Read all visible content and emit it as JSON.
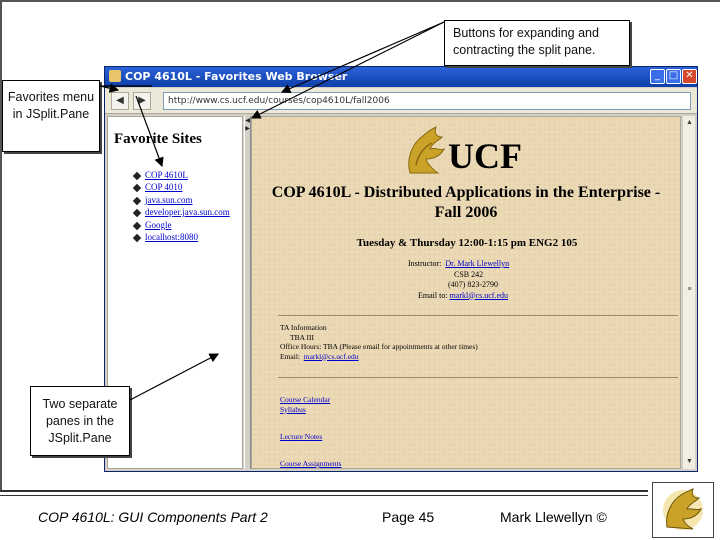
{
  "window": {
    "title": "COP 4610L - Favorites Web Browser",
    "min_glyph": "_",
    "max_glyph": "□",
    "close_glyph": "✕",
    "back_glyph": "◀",
    "forward_glyph": "▶",
    "address": "http://www.cs.ucf.edu/courses/cop4610L/fall2006"
  },
  "favorites": {
    "heading": "Favorite Sites",
    "items": [
      "COP 4610L",
      "COP 4010",
      "java.sun.com",
      "developer.java.sun.com",
      "Google",
      "localhost:8080"
    ]
  },
  "page": {
    "logo_text": "UCF",
    "course_title": "COP 4610L - Distributed Applications in the Enterprise - Fall 2006",
    "schedule": "Tuesday & Thursday 12:00-1:15 pm ENG2 105",
    "instructor_label": "Instructor:",
    "instructor_name": "Dr. Mark Llewellyn",
    "office": "CSB 242",
    "phone": "(407) 823-2790",
    "email_label": "Email to:",
    "email": "markl@cs.ucf.edu",
    "ta_heading": "TA Information",
    "ta_name": "TBA III",
    "office_hours": "Office Hours:  TBA  (Please email for appointments at other times)",
    "ta_email_label": "Email:",
    "ta_email": "markl@cs.ucf.edu",
    "links": [
      "Course Calendar",
      "Syllabus",
      "Lecture Notes",
      "Course Assignments"
    ]
  },
  "callouts": {
    "buttons": "Buttons for expanding and contracting the split pane.",
    "favorites": "Favorites menu in JSplit.Pane",
    "panes": "Two separate panes in the JSplit.Pane"
  },
  "footer": {
    "left": "COP 4610L: GUI Components Part 2",
    "page": "Page 45",
    "author": "Mark Llewellyn ©"
  },
  "colors": {
    "titlebar": "#0f3fa8",
    "page_background": "#ead9b4",
    "ucf_gold": "#c9a227",
    "link": "#0000cc"
  }
}
